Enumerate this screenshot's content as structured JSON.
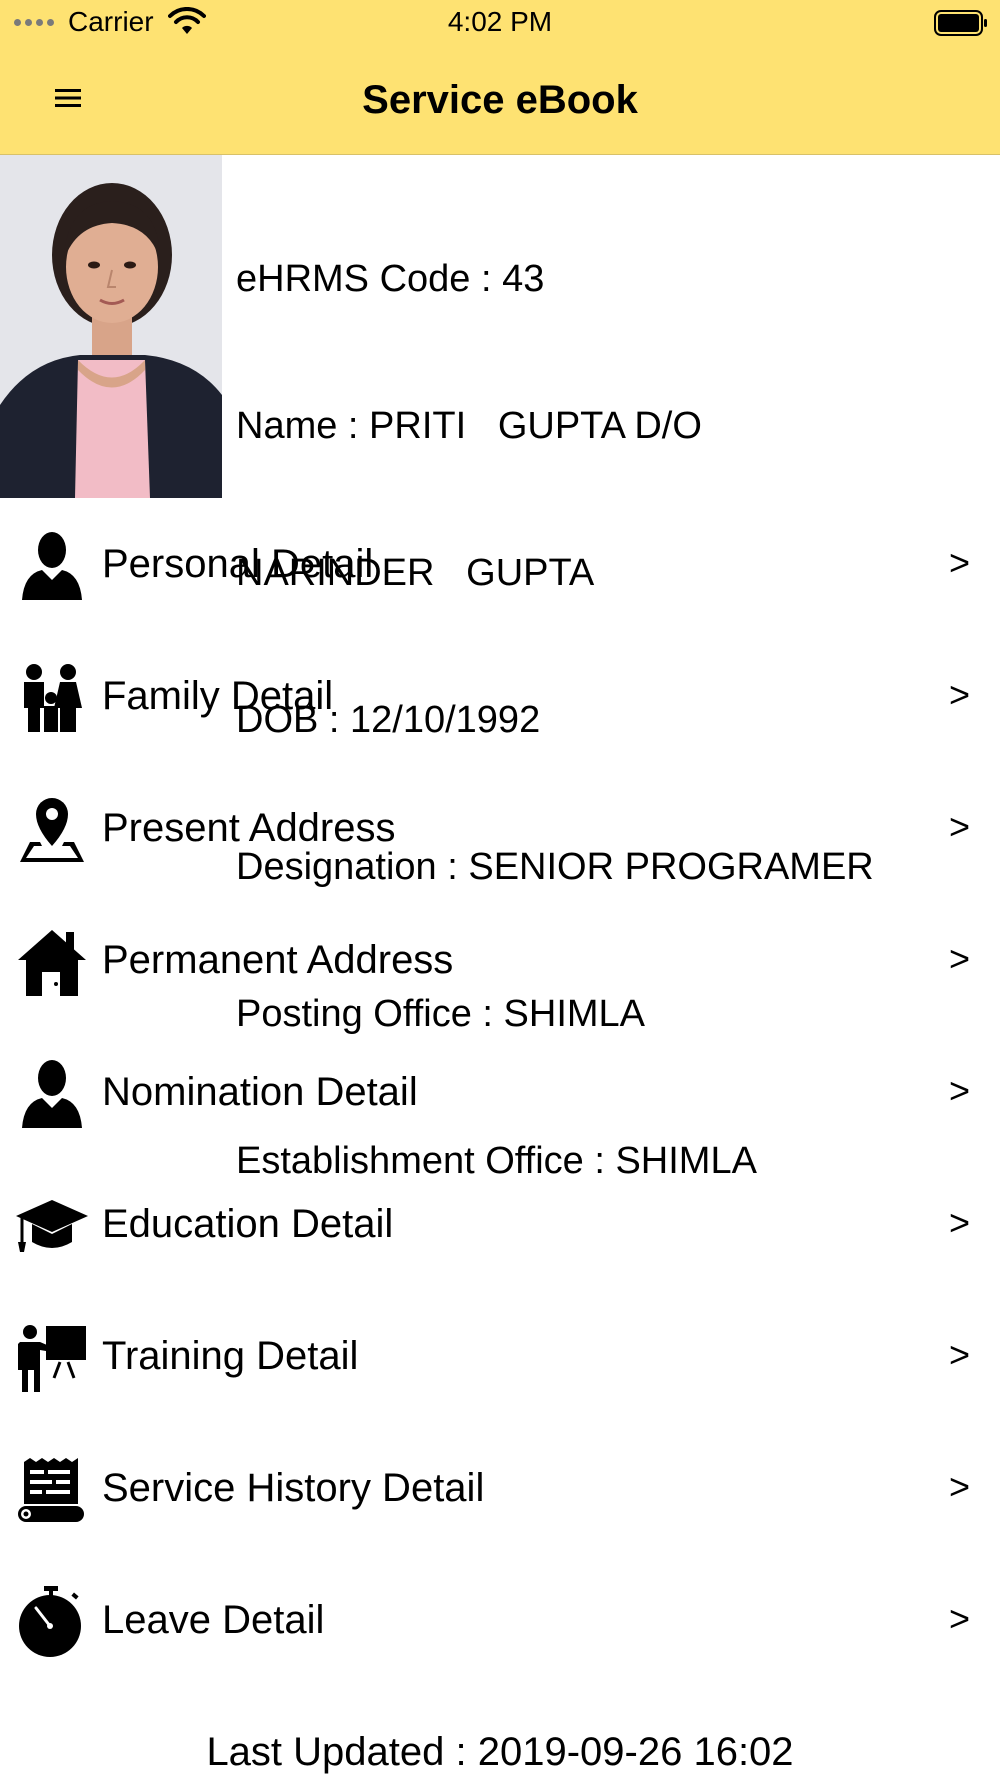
{
  "status_bar": {
    "carrier": "Carrier",
    "time": "4:02 PM"
  },
  "header": {
    "title": "Service eBook"
  },
  "profile": {
    "lines": [
      "eHRMS Code : 43",
      "Name : PRITI   GUPTA D/O",
      "NARINDER   GUPTA",
      "DOB : 12/10/1992",
      "Designation : SENIOR PROGRAMER",
      "Posting Office : SHIMLA",
      "Establishment Office : SHIMLA"
    ]
  },
  "menu": {
    "items": [
      {
        "label": "Personal Detail",
        "icon": "person-icon",
        "arrow": ">"
      },
      {
        "label": "Family Detail",
        "icon": "family-icon",
        "arrow": ">"
      },
      {
        "label": "Present Address",
        "icon": "map-pin-icon",
        "arrow": ">"
      },
      {
        "label": "Permanent Address",
        "icon": "house-icon",
        "arrow": ">"
      },
      {
        "label": "Nomination Detail",
        "icon": "person-icon",
        "arrow": ">"
      },
      {
        "label": "Education Detail",
        "icon": "graduation-cap-icon",
        "arrow": ">"
      },
      {
        "label": "Training Detail",
        "icon": "trainer-board-icon",
        "arrow": ">"
      },
      {
        "label": "Service History Detail",
        "icon": "scroll-document-icon",
        "arrow": ">"
      },
      {
        "label": "Leave Detail",
        "icon": "stopwatch-icon",
        "arrow": ">"
      }
    ]
  },
  "footer": {
    "last_updated": "Last Updated : 2019-09-26 16:02"
  },
  "colors": {
    "header_bg": "#FEE272",
    "text": "#000000"
  }
}
